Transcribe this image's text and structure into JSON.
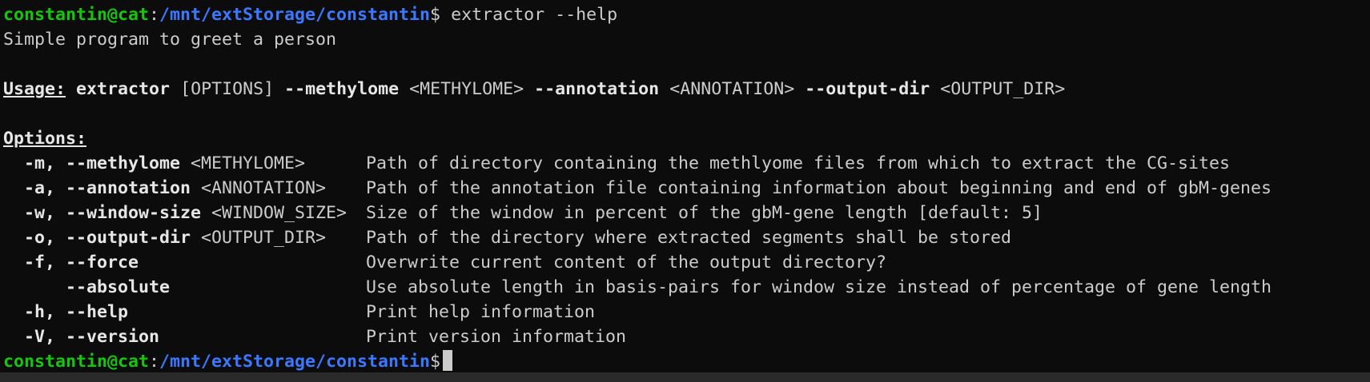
{
  "prompt": {
    "user_host": "constantin@cat",
    "separator": ":",
    "path": "/mnt/extStorage/constantin",
    "symbol": "$"
  },
  "command": " extractor --help",
  "description": "Simple program to greet a person",
  "usage": {
    "label": "Usage:",
    "binary": "extractor",
    "options_token": "[OPTIONS]",
    "flag_methylome": "--methylome",
    "arg_methylome": "<METHYLOME>",
    "flag_annotation": "--annotation",
    "arg_annotation": "<ANNOTATION>",
    "flag_output": "--output-dir",
    "arg_output": "<OUTPUT_DIR>"
  },
  "options_header": "Options:",
  "options": [
    {
      "flags": "  -m, --methylome",
      "arg": " <METHYLOME>",
      "desc": "Path of directory containing the methlyome files from which to extract the CG-sites"
    },
    {
      "flags": "  -a, --annotation",
      "arg": " <ANNOTATION>",
      "desc": "Path of the annotation file containing information about beginning and end of gbM-genes"
    },
    {
      "flags": "  -w, --window-size",
      "arg": " <WINDOW_SIZE>",
      "desc": "Size of the window in percent of the gbM-gene length [default: 5]"
    },
    {
      "flags": "  -o, --output-dir",
      "arg": " <OUTPUT_DIR>",
      "desc": "Path of the directory where extracted segments shall be stored"
    },
    {
      "flags": "  -f, --force",
      "arg": "",
      "desc": "Overwrite current content of the output directory?"
    },
    {
      "flags": "      --absolute",
      "arg": "",
      "desc": "Use absolute length in basis-pairs for window size instead of percentage of gene length"
    },
    {
      "flags": "  -h, --help",
      "arg": "",
      "desc": "Print help information"
    },
    {
      "flags": "  -V, --version",
      "arg": "",
      "desc": "Print version information"
    }
  ],
  "colors": {
    "background": "#0c0c0c",
    "text": "#cccccc",
    "user_host": "#16c60c",
    "path": "#3b78ff"
  }
}
